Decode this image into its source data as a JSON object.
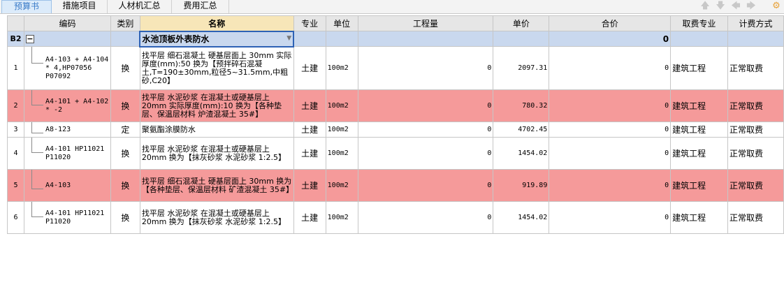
{
  "tabs": [
    "预算书",
    "措施项目",
    "人材机汇总",
    "费用汇总"
  ],
  "columns": [
    "编码",
    "类别",
    "名称",
    "专业",
    "单位",
    "工程量",
    "单价",
    "合价",
    "取费专业",
    "计费方式"
  ],
  "group": {
    "label": "B2",
    "name": "水池顶板外表防水",
    "total": "0"
  },
  "rows": [
    {
      "num": "1",
      "code": "A4-103 + A4-104 * 4,HP07056 P07092",
      "type": "换",
      "name": "找平层 细石混凝土 硬基层面上 30mm 实际厚度(mm):50 换为【预拌碎石混凝土,T=190±30mm,粒径5~31.5mm,中粗砂,C20】",
      "spec": "土建",
      "unit": "100m2",
      "qty": "0",
      "price": "2097.31",
      "total": "0",
      "fee": "建筑工程",
      "method": "正常取费",
      "highlight": false
    },
    {
      "num": "2",
      "code": "A4-101 + A4-102 * -2",
      "type": "换",
      "name": "找平层 水泥砂浆 在混凝土或硬基层上 20mm 实际厚度(mm):10 换为【各种垫层、保温层材料 炉渣混凝土 35#】",
      "spec": "土建",
      "unit": "100m2",
      "qty": "0",
      "price": "780.32",
      "total": "0",
      "fee": "建筑工程",
      "method": "正常取费",
      "highlight": true
    },
    {
      "num": "3",
      "code": "A8-123",
      "type": "定",
      "name": "聚氨酯涂膜防水",
      "spec": "土建",
      "unit": "100m2",
      "qty": "0",
      "price": "4702.45",
      "total": "0",
      "fee": "建筑工程",
      "method": "正常取费",
      "highlight": false
    },
    {
      "num": "4",
      "code": "A4-101 HP11021 P11020",
      "type": "换",
      "name": "找平层 水泥砂浆 在混凝土或硬基层上 20mm 换为【抹灰砂浆 水泥砂浆 1:2.5】",
      "spec": "土建",
      "unit": "100m2",
      "qty": "0",
      "price": "1454.02",
      "total": "0",
      "fee": "建筑工程",
      "method": "正常取费",
      "highlight": false
    },
    {
      "num": "5",
      "code": "A4-103",
      "type": "换",
      "name": "找平层 细石混凝土 硬基层面上 30mm 换为【各种垫层、保温层材料 矿渣混凝土 35#】",
      "spec": "土建",
      "unit": "100m2",
      "qty": "0",
      "price": "919.89",
      "total": "0",
      "fee": "建筑工程",
      "method": "正常取费",
      "highlight": true
    },
    {
      "num": "6",
      "code": "A4-101 HP11021 P11020",
      "type": "换",
      "name": "找平层 水泥砂浆 在混凝土或硬基层上 20mm 换为【抹灰砂浆 水泥砂浆 1:2.5】",
      "spec": "土建",
      "unit": "100m2",
      "qty": "0",
      "price": "1454.02",
      "total": "0",
      "fee": "建筑工程",
      "method": "正常取费",
      "highlight": false
    }
  ],
  "icons": [
    "arrow-up-icon",
    "arrow-down-icon",
    "arrow-left-icon",
    "arrow-right-icon",
    "settings-icon"
  ]
}
